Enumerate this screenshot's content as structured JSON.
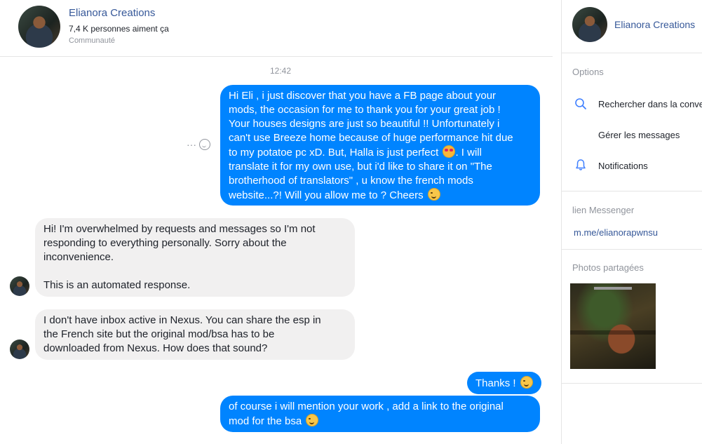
{
  "header": {
    "page_name": "Elianora Creations",
    "likes": "7,4 K personnes aiment ça",
    "category": "Communauté"
  },
  "conversation": {
    "timestamp": "12:42",
    "messages": [
      {
        "from": "me",
        "lines": [
          "Hi Eli , i just discover that you have a FB page about your",
          "mods, the occasion for me to thank you for your great job !",
          "Your houses designs are just so beautiful !! Unfortunately i",
          "can't use Breeze home because of huge performance hit due",
          "to my potatoe pc xD. But, Halla is just perfect",
          ". I will",
          "translate it for my own use, but i'd like to share it on \"The",
          "brotherhood of translators\" , u know the french mods",
          "website...?!  Will you allow me to ? Cheers"
        ]
      },
      {
        "from": "page",
        "lines": [
          "Hi! I'm overwhelmed by requests and messages so I'm not",
          "responding to everything personally. Sorry about the",
          "inconvenience.",
          "This is an automated response."
        ]
      },
      {
        "from": "page",
        "lines": [
          "I don't have inbox active in Nexus. You can share the esp in",
          "the French site but the original mod/bsa has to be",
          "downloaded from Nexus. How does that sound?"
        ]
      },
      {
        "from": "me",
        "lines": [
          "Thanks !"
        ]
      },
      {
        "from": "me",
        "lines": [
          "of course i will mention your work , add a link to the original",
          "mod for the bsa"
        ]
      }
    ],
    "actions": {
      "more": "···"
    }
  },
  "sidebar": {
    "page_name": "Elianora Creations",
    "options_heading": "Options",
    "search_label": "Rechercher dans la conversation",
    "manage_label": "Gérer les messages",
    "notifications_label": "Notifications",
    "link_heading": "lien Messenger",
    "link": "m.me/elianorapwnsu",
    "photos_heading": "Photos partagées"
  },
  "colors": {
    "outgoing_bubble": "#0084ff",
    "incoming_bubble": "#f1f0f0",
    "link": "#365899",
    "muted": "#90949c"
  },
  "icons": [
    "search-icon",
    "bell-icon",
    "smile-icon",
    "more-icon",
    "emoji-heart-eyes-icon",
    "emoji-wink-icon"
  ]
}
